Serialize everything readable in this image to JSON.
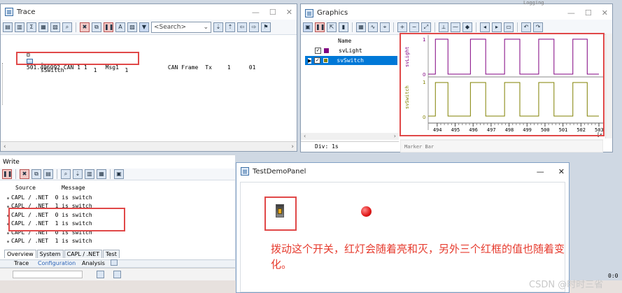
{
  "trace": {
    "title": "Trace",
    "search_placeholder": "<Search>",
    "row1": {
      "prefix": "⊟",
      "time": "501.406092",
      "channel": "CAN 1",
      "id": "1",
      "name": "Msg1",
      "type": "CAN Frame",
      "dir": "Tx",
      "dlc": "1",
      "data": "01"
    },
    "row2": {
      "signal": "sSwitch",
      "raw": "1",
      "phys": "1"
    }
  },
  "graphics": {
    "title": "Graphics",
    "header_name": "Name",
    "signals": [
      {
        "name": "svLight",
        "color": "#800080"
      },
      {
        "name": "svSwitch",
        "color": "#808000"
      }
    ],
    "div_label": "Div: 1s",
    "marker_bar": "Marker Bar",
    "logging": "Logging",
    "axis_label_top": "svLight",
    "axis_label_bottom": "svSwitch",
    "y_top_high": "1",
    "y_top_low": "0",
    "y_bot_high": "1",
    "y_bot_low": "0",
    "x_ticks": [
      "494",
      "495",
      "496",
      "497",
      "498",
      "499",
      "500",
      "501",
      "502",
      "503"
    ],
    "x_unit": "[s]",
    "chart_data": {
      "type": "line",
      "x_range": [
        493.5,
        503
      ],
      "series": [
        {
          "name": "svLight",
          "transitions": [
            [
              493.5,
              0
            ],
            [
              493.9,
              1
            ],
            [
              494.6,
              0
            ],
            [
              495.85,
              1
            ],
            [
              496.7,
              0
            ],
            [
              497.75,
              1
            ],
            [
              498.6,
              0
            ],
            [
              499.65,
              1
            ],
            [
              500.5,
              0
            ],
            [
              501.55,
              1
            ],
            [
              502.35,
              0
            ]
          ]
        },
        {
          "name": "svSwitch",
          "transitions": [
            [
              493.5,
              0
            ],
            [
              493.9,
              1
            ],
            [
              494.6,
              0
            ],
            [
              495.85,
              1
            ],
            [
              496.7,
              0
            ],
            [
              497.75,
              1
            ],
            [
              498.6,
              0
            ],
            [
              499.65,
              1
            ],
            [
              500.5,
              0
            ],
            [
              501.55,
              1
            ],
            [
              502.35,
              0
            ]
          ]
        }
      ]
    }
  },
  "write": {
    "title": "Write",
    "col_source": "Source",
    "col_message": "Message",
    "rows": [
      {
        "source": "CAPL / .NET",
        "message": "0 is switch"
      },
      {
        "source": "CAPL / .NET",
        "message": "1 is switch"
      },
      {
        "source": "CAPL / .NET",
        "message": "0 is switch"
      },
      {
        "source": "CAPL / .NET",
        "message": "1 is switch"
      },
      {
        "source": "CAPL / .NET",
        "message": "0 is switch"
      },
      {
        "source": "CAPL / .NET",
        "message": "1 is switch"
      }
    ],
    "tabs": [
      "Overview",
      "System",
      "CAPL / .NET",
      "Test"
    ],
    "bottom_tabs": [
      "Trace",
      "Configuration",
      "Analysis"
    ]
  },
  "panel": {
    "title": "TestDemoPanel",
    "annotation_line1": "拨动这个开关，红灯会随着亮和灭，另外三个红框的值也随着变",
    "annotation_line2": "化。"
  },
  "watermark": "CSDN @时时三省",
  "corner_text": "0:0"
}
